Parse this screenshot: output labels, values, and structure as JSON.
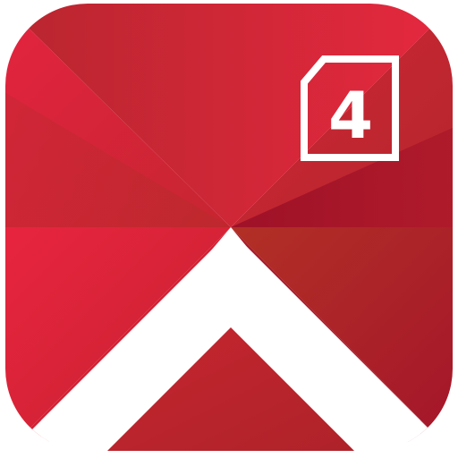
{
  "app_icon": {
    "badge": {
      "digit": "4"
    },
    "colors": {
      "brand_red": "#E42440",
      "dark_red": "#9E1128",
      "mid_red": "#C8222E",
      "rust_red": "#B02A29",
      "chevron_white": "#FFFFFF",
      "badge_outline": "#FFFFFF"
    },
    "icon_names": [
      "app-icon",
      "chevron-up-icon",
      "badge-four-icon"
    ]
  }
}
